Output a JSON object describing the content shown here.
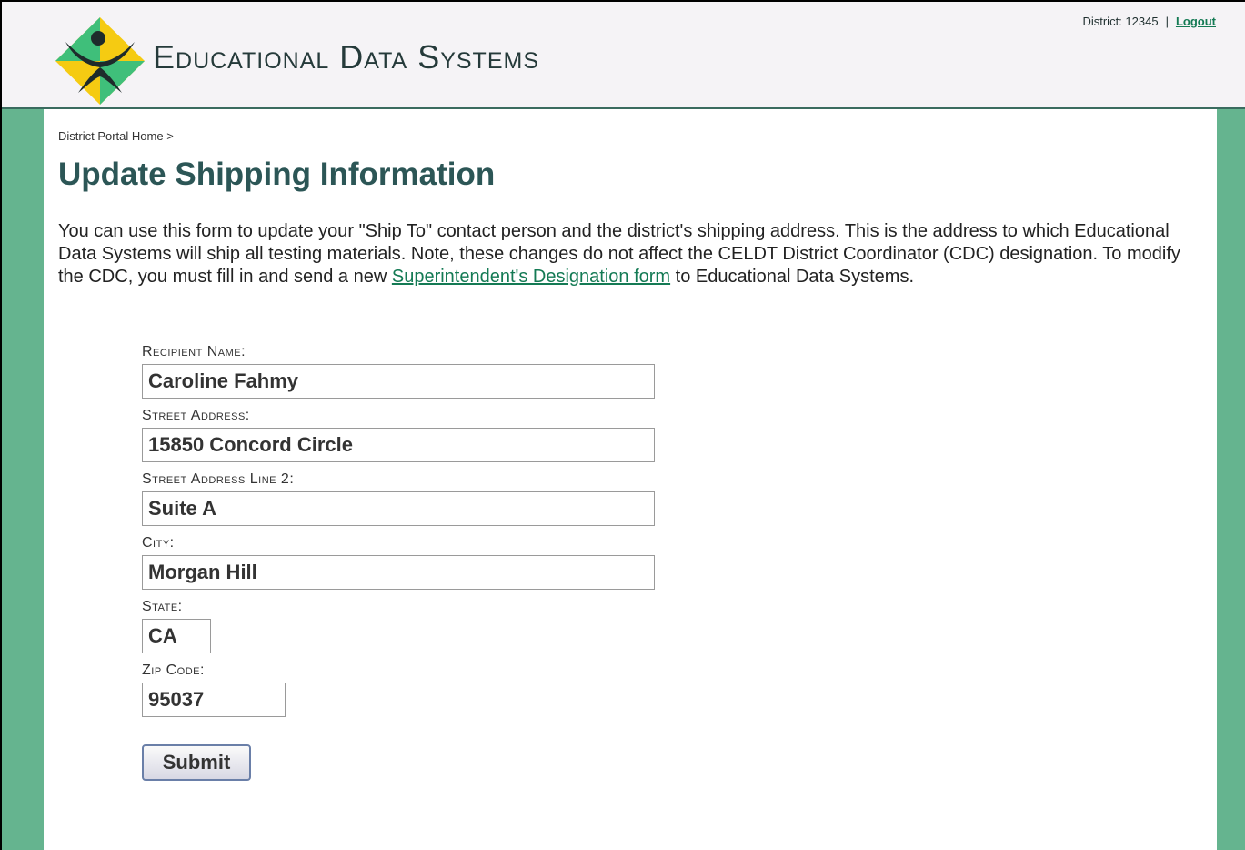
{
  "header": {
    "brand": "Educational Data Systems",
    "district_label": "District: 12345",
    "separator": "|",
    "logout_label": "Logout"
  },
  "breadcrumb": "District Portal Home >",
  "page_title": "Update Shipping Information",
  "intro": {
    "text_before_link": "You can use this form to update your \"Ship To\" contact person and the district's shipping address. This is the address to which Educational Data Systems will ship all testing materials. Note, these changes do not affect the CELDT District Coordinator (CDC) designation. To modify the CDC, you must fill in and send a new ",
    "link_text": "Superintendent's Designation form",
    "text_after_link": " to Educational Data Systems."
  },
  "form": {
    "recipient_label": "Recipient Name:",
    "recipient_value": "Caroline Fahmy",
    "street_label": "Street Address:",
    "street_value": "15850 Concord Circle",
    "street2_label": "Street Address Line 2:",
    "street2_value": "Suite A",
    "city_label": "City:",
    "city_value": "Morgan Hill",
    "state_label": "State:",
    "state_value": "CA",
    "zip_label": "Zip Code:",
    "zip_value": "95037",
    "submit_label": "Submit"
  },
  "colors": {
    "frame_green": "#65b48f",
    "title_teal": "#2c5656",
    "link_green": "#147a54",
    "logo_green": "#3fbf7a",
    "logo_yellow": "#f5cb12",
    "logo_figure": "#1e2b2b"
  },
  "icons": {
    "logo": "edu-data-systems-logo-icon"
  }
}
